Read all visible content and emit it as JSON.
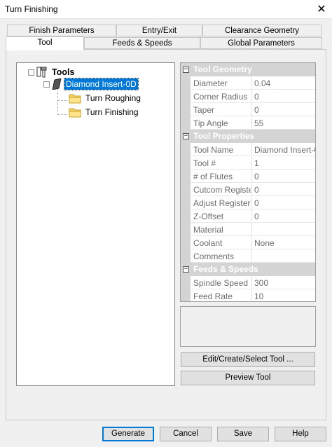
{
  "window": {
    "title": "Turn Finishing",
    "close_glyph": "✕"
  },
  "tabs_top": [
    {
      "label": "Finish Parameters"
    },
    {
      "label": "Entry/Exit"
    },
    {
      "label": "Clearance Geometry"
    }
  ],
  "tabs_bottom": [
    {
      "label": "Tool",
      "active": true
    },
    {
      "label": "Feeds & Speeds"
    },
    {
      "label": "Global Parameters"
    }
  ],
  "tree": {
    "root_label": "Tools",
    "root_expander": "⊟",
    "tool_label": "Diamond Insert-0D",
    "tool_expander": "⊟",
    "children": [
      {
        "label": "Turn Roughing"
      },
      {
        "label": "Turn Finishing"
      }
    ]
  },
  "property_grid": {
    "expander_glyph": "−",
    "categories": [
      {
        "name": "Tool Geometry",
        "rows": [
          {
            "name": "Diameter",
            "value": "0.04"
          },
          {
            "name": "Corner Radius",
            "value": "0"
          },
          {
            "name": "Taper",
            "value": "0"
          },
          {
            "name": "Tip Angle",
            "value": "55"
          }
        ]
      },
      {
        "name": "Tool Properties",
        "rows": [
          {
            "name": "Tool Name",
            "value": "Diamond Insert-0"
          },
          {
            "name": "Tool #",
            "value": "1"
          },
          {
            "name": "# of Flutes",
            "value": "0"
          },
          {
            "name": "Cutcom Registe",
            "value": "0"
          },
          {
            "name": "Adjust Register",
            "value": "0"
          },
          {
            "name": "Z-Offset",
            "value": "0"
          },
          {
            "name": "Material",
            "value": ""
          },
          {
            "name": "Coolant",
            "value": "None"
          },
          {
            "name": "Comments",
            "value": ""
          }
        ]
      },
      {
        "name": "Feeds & Speeds",
        "rows": [
          {
            "name": "Spindle Speed",
            "value": "300"
          },
          {
            "name": "Feed Rate",
            "value": "10"
          }
        ]
      }
    ]
  },
  "buttons": {
    "edit_tool": "Edit/Create/Select Tool ...",
    "preview_tool": "Preview Tool",
    "generate": "Generate",
    "cancel": "Cancel",
    "save": "Save",
    "help": "Help"
  },
  "colors": {
    "selection": "#0078d7",
    "category_bg": "#d4d4d4",
    "dialog_bg": "#f0f0f0"
  }
}
